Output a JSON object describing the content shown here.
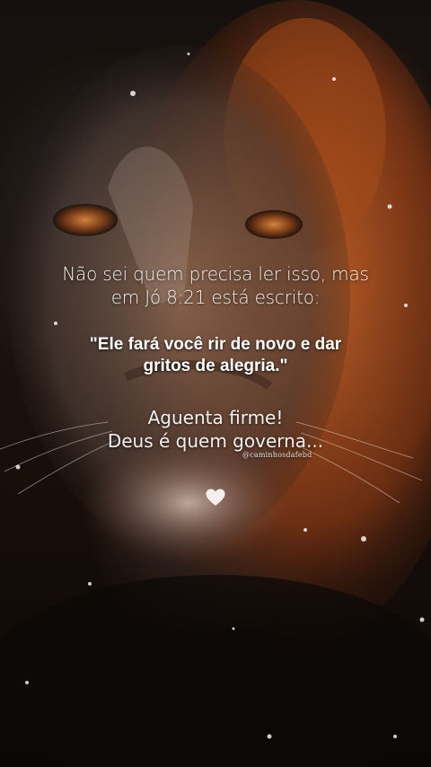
{
  "intro": {
    "line1": "Não sei quem precisa ler isso, mas",
    "line2": "em Jó 8:21 está escrito:"
  },
  "verse": {
    "line1": "\"Ele fará você rir de novo e dar",
    "line2": "gritos de alegria.\""
  },
  "closing": {
    "line1": "Aguenta firme!",
    "line2": "Deus é quem governa..."
  },
  "watermark": "@caminhosdafebd",
  "icons": {
    "heart": "heart-icon"
  },
  "colors": {
    "text": "#f3f0ee",
    "mane": "#b4521f",
    "background": "#0b0b0d"
  }
}
